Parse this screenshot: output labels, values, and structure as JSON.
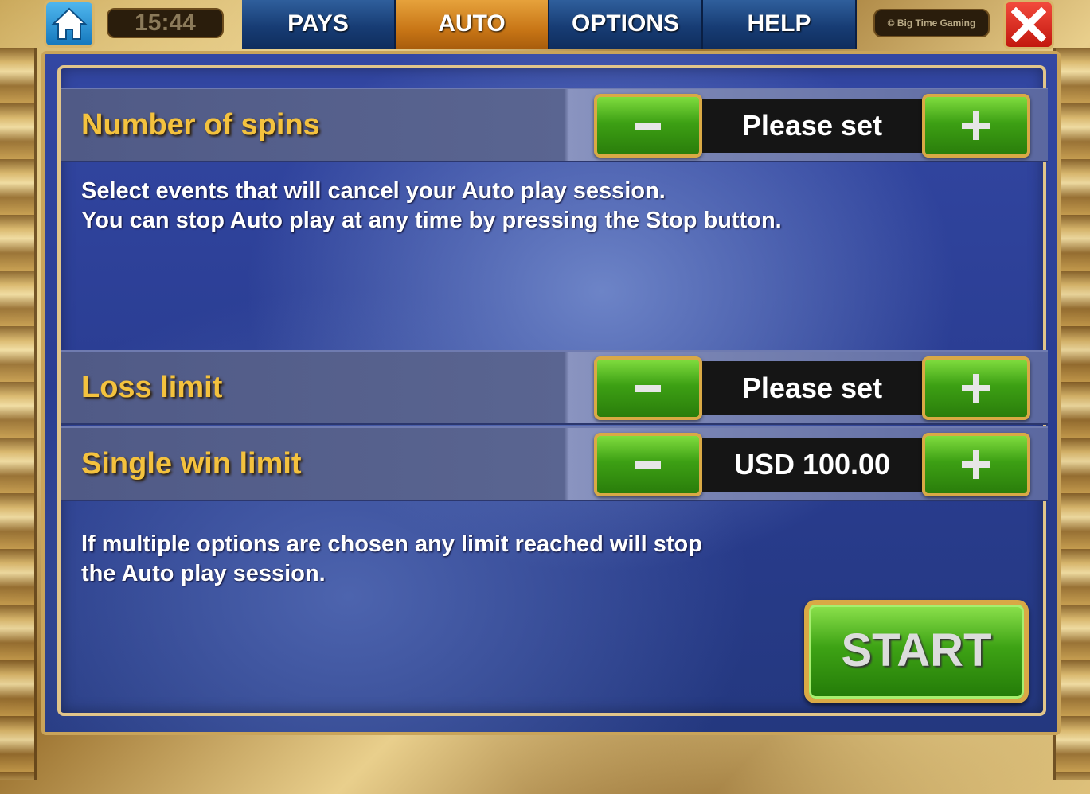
{
  "topbar": {
    "clock": "15:44",
    "tabs": [
      {
        "label": "PAYS",
        "active": false
      },
      {
        "label": "AUTO",
        "active": true
      },
      {
        "label": "OPTIONS",
        "active": false
      },
      {
        "label": "HELP",
        "active": false
      }
    ],
    "brand": "© Big Time Gaming",
    "home_icon": "home-icon",
    "close_icon": "close-icon"
  },
  "auto": {
    "spins": {
      "label": "Number of spins",
      "value": "Please set"
    },
    "cancel_info_line1": "Select events that will cancel your Auto play session.",
    "cancel_info_line2": "You can stop Auto play at any time by pressing the Stop button.",
    "loss_limit": {
      "label": "Loss limit",
      "value": "Please set"
    },
    "single_win_limit": {
      "label": "Single win limit",
      "value": "USD 100.00"
    },
    "multi_info_line1": "If multiple options are chosen any limit reached will stop",
    "multi_info_line2": "the Auto play session.",
    "start_label": "START"
  },
  "colors": {
    "accent_gold": "#f4c23e",
    "tab_active": "#c87616",
    "tab_inactive": "#173c74",
    "button_green": "#3da014",
    "close_red": "#c2170e"
  }
}
